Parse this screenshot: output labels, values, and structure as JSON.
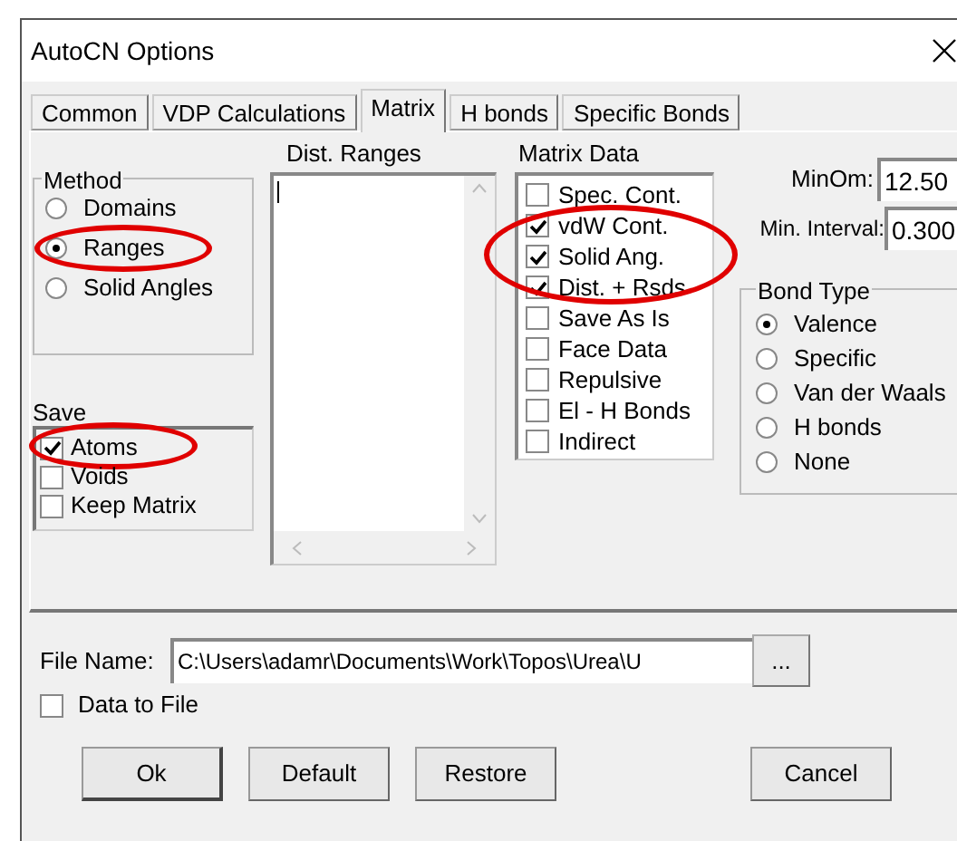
{
  "window": {
    "title": "AutoCN Options"
  },
  "tabs": [
    {
      "label": "Common",
      "selected": false
    },
    {
      "label": "VDP Calculations",
      "selected": false
    },
    {
      "label": "Matrix",
      "selected": true
    },
    {
      "label": "H bonds",
      "selected": false
    },
    {
      "label": "Specific Bonds",
      "selected": false
    }
  ],
  "method": {
    "title": "Method",
    "options": [
      {
        "label": "Domains",
        "selected": false,
        "circled": false
      },
      {
        "label": "Ranges",
        "selected": true,
        "circled": true
      },
      {
        "label": "Solid Angles",
        "selected": false,
        "circled": false
      }
    ]
  },
  "save": {
    "title": "Save",
    "items": [
      {
        "label": "Atoms",
        "checked": true,
        "circled": true
      },
      {
        "label": "Voids",
        "checked": false,
        "circled": false
      },
      {
        "label": "Keep Matrix",
        "checked": false,
        "circled": false
      }
    ]
  },
  "dist_ranges": {
    "label": "Dist. Ranges"
  },
  "matrix_data": {
    "label": "Matrix Data",
    "items": [
      {
        "label": "Spec. Cont.",
        "checked": false,
        "circled": false
      },
      {
        "label": "vdW Cont.",
        "checked": true,
        "circled": true
      },
      {
        "label": "Solid Ang.",
        "checked": true,
        "circled": true
      },
      {
        "label": "Dist. + Rsds",
        "checked": true,
        "circled": true
      },
      {
        "label": "Save As Is",
        "checked": false,
        "circled": false
      },
      {
        "label": "Face Data",
        "checked": false,
        "circled": false
      },
      {
        "label": "Repulsive",
        "checked": false,
        "circled": false
      },
      {
        "label": "El - H Bonds",
        "checked": false,
        "circled": false
      },
      {
        "label": "Indirect",
        "checked": false,
        "circled": false
      }
    ]
  },
  "min_om": {
    "label": "MinOm:",
    "value": "12.50"
  },
  "min_interval": {
    "label": "Min. Interval:",
    "value": "0.300"
  },
  "bond_type": {
    "title": "Bond Type",
    "options": [
      {
        "label": "Valence",
        "selected": true
      },
      {
        "label": "Specific",
        "selected": false
      },
      {
        "label": "Van der Waals",
        "selected": false
      },
      {
        "label": "H bonds",
        "selected": false
      },
      {
        "label": "None",
        "selected": false
      }
    ]
  },
  "file_name": {
    "label": "File Name:",
    "value": "C:\\Users\\adamr\\Documents\\Work\\Topos\\Urea\\U",
    "browse": "..."
  },
  "data_to_file": {
    "label": "Data to File",
    "checked": false
  },
  "buttons": [
    {
      "label": "Ok",
      "default": true
    },
    {
      "label": "Default",
      "default": false
    },
    {
      "label": "Restore",
      "default": false
    },
    {
      "label": "Cancel",
      "default": false
    }
  ]
}
